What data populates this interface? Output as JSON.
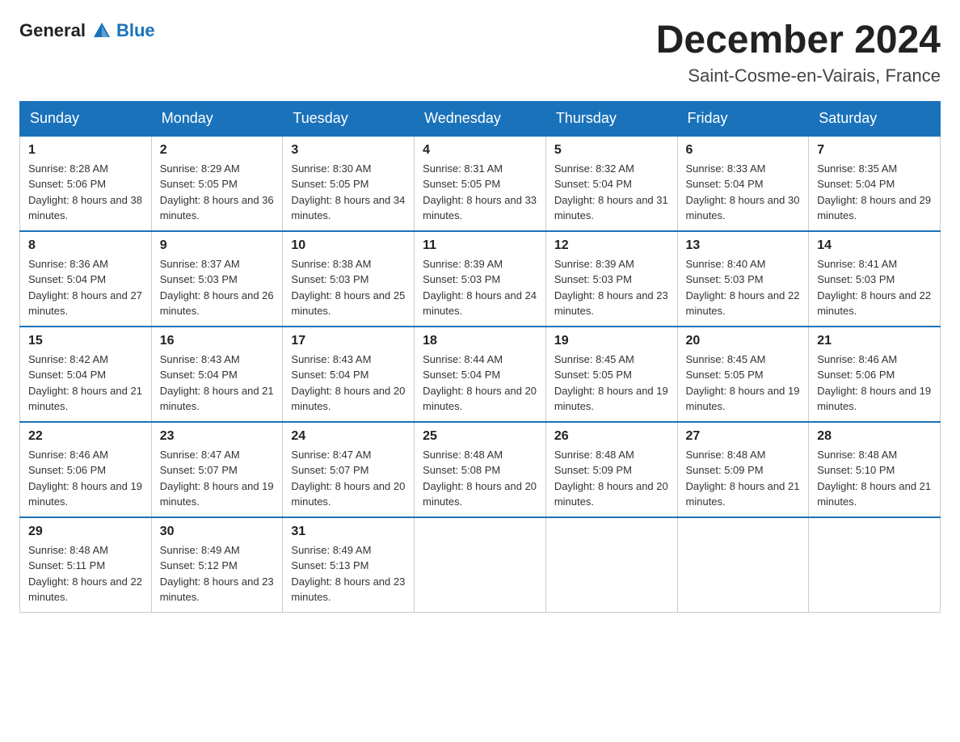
{
  "header": {
    "logo": {
      "text_general": "General",
      "text_blue": "Blue",
      "arrow_color": "#1a72bb"
    },
    "title": "December 2024",
    "location": "Saint-Cosme-en-Vairais, France"
  },
  "weekdays": [
    "Sunday",
    "Monday",
    "Tuesday",
    "Wednesday",
    "Thursday",
    "Friday",
    "Saturday"
  ],
  "weeks": [
    [
      {
        "day": "1",
        "sunrise": "8:28 AM",
        "sunset": "5:06 PM",
        "daylight": "8 hours and 38 minutes."
      },
      {
        "day": "2",
        "sunrise": "8:29 AM",
        "sunset": "5:05 PM",
        "daylight": "8 hours and 36 minutes."
      },
      {
        "day": "3",
        "sunrise": "8:30 AM",
        "sunset": "5:05 PM",
        "daylight": "8 hours and 34 minutes."
      },
      {
        "day": "4",
        "sunrise": "8:31 AM",
        "sunset": "5:05 PM",
        "daylight": "8 hours and 33 minutes."
      },
      {
        "day": "5",
        "sunrise": "8:32 AM",
        "sunset": "5:04 PM",
        "daylight": "8 hours and 31 minutes."
      },
      {
        "day": "6",
        "sunrise": "8:33 AM",
        "sunset": "5:04 PM",
        "daylight": "8 hours and 30 minutes."
      },
      {
        "day": "7",
        "sunrise": "8:35 AM",
        "sunset": "5:04 PM",
        "daylight": "8 hours and 29 minutes."
      }
    ],
    [
      {
        "day": "8",
        "sunrise": "8:36 AM",
        "sunset": "5:04 PM",
        "daylight": "8 hours and 27 minutes."
      },
      {
        "day": "9",
        "sunrise": "8:37 AM",
        "sunset": "5:03 PM",
        "daylight": "8 hours and 26 minutes."
      },
      {
        "day": "10",
        "sunrise": "8:38 AM",
        "sunset": "5:03 PM",
        "daylight": "8 hours and 25 minutes."
      },
      {
        "day": "11",
        "sunrise": "8:39 AM",
        "sunset": "5:03 PM",
        "daylight": "8 hours and 24 minutes."
      },
      {
        "day": "12",
        "sunrise": "8:39 AM",
        "sunset": "5:03 PM",
        "daylight": "8 hours and 23 minutes."
      },
      {
        "day": "13",
        "sunrise": "8:40 AM",
        "sunset": "5:03 PM",
        "daylight": "8 hours and 22 minutes."
      },
      {
        "day": "14",
        "sunrise": "8:41 AM",
        "sunset": "5:03 PM",
        "daylight": "8 hours and 22 minutes."
      }
    ],
    [
      {
        "day": "15",
        "sunrise": "8:42 AM",
        "sunset": "5:04 PM",
        "daylight": "8 hours and 21 minutes."
      },
      {
        "day": "16",
        "sunrise": "8:43 AM",
        "sunset": "5:04 PM",
        "daylight": "8 hours and 21 minutes."
      },
      {
        "day": "17",
        "sunrise": "8:43 AM",
        "sunset": "5:04 PM",
        "daylight": "8 hours and 20 minutes."
      },
      {
        "day": "18",
        "sunrise": "8:44 AM",
        "sunset": "5:04 PM",
        "daylight": "8 hours and 20 minutes."
      },
      {
        "day": "19",
        "sunrise": "8:45 AM",
        "sunset": "5:05 PM",
        "daylight": "8 hours and 19 minutes."
      },
      {
        "day": "20",
        "sunrise": "8:45 AM",
        "sunset": "5:05 PM",
        "daylight": "8 hours and 19 minutes."
      },
      {
        "day": "21",
        "sunrise": "8:46 AM",
        "sunset": "5:06 PM",
        "daylight": "8 hours and 19 minutes."
      }
    ],
    [
      {
        "day": "22",
        "sunrise": "8:46 AM",
        "sunset": "5:06 PM",
        "daylight": "8 hours and 19 minutes."
      },
      {
        "day": "23",
        "sunrise": "8:47 AM",
        "sunset": "5:07 PM",
        "daylight": "8 hours and 19 minutes."
      },
      {
        "day": "24",
        "sunrise": "8:47 AM",
        "sunset": "5:07 PM",
        "daylight": "8 hours and 20 minutes."
      },
      {
        "day": "25",
        "sunrise": "8:48 AM",
        "sunset": "5:08 PM",
        "daylight": "8 hours and 20 minutes."
      },
      {
        "day": "26",
        "sunrise": "8:48 AM",
        "sunset": "5:09 PM",
        "daylight": "8 hours and 20 minutes."
      },
      {
        "day": "27",
        "sunrise": "8:48 AM",
        "sunset": "5:09 PM",
        "daylight": "8 hours and 21 minutes."
      },
      {
        "day": "28",
        "sunrise": "8:48 AM",
        "sunset": "5:10 PM",
        "daylight": "8 hours and 21 minutes."
      }
    ],
    [
      {
        "day": "29",
        "sunrise": "8:48 AM",
        "sunset": "5:11 PM",
        "daylight": "8 hours and 22 minutes."
      },
      {
        "day": "30",
        "sunrise": "8:49 AM",
        "sunset": "5:12 PM",
        "daylight": "8 hours and 23 minutes."
      },
      {
        "day": "31",
        "sunrise": "8:49 AM",
        "sunset": "5:13 PM",
        "daylight": "8 hours and 23 minutes."
      },
      null,
      null,
      null,
      null
    ]
  ],
  "labels": {
    "sunrise": "Sunrise:",
    "sunset": "Sunset:",
    "daylight": "Daylight:"
  }
}
